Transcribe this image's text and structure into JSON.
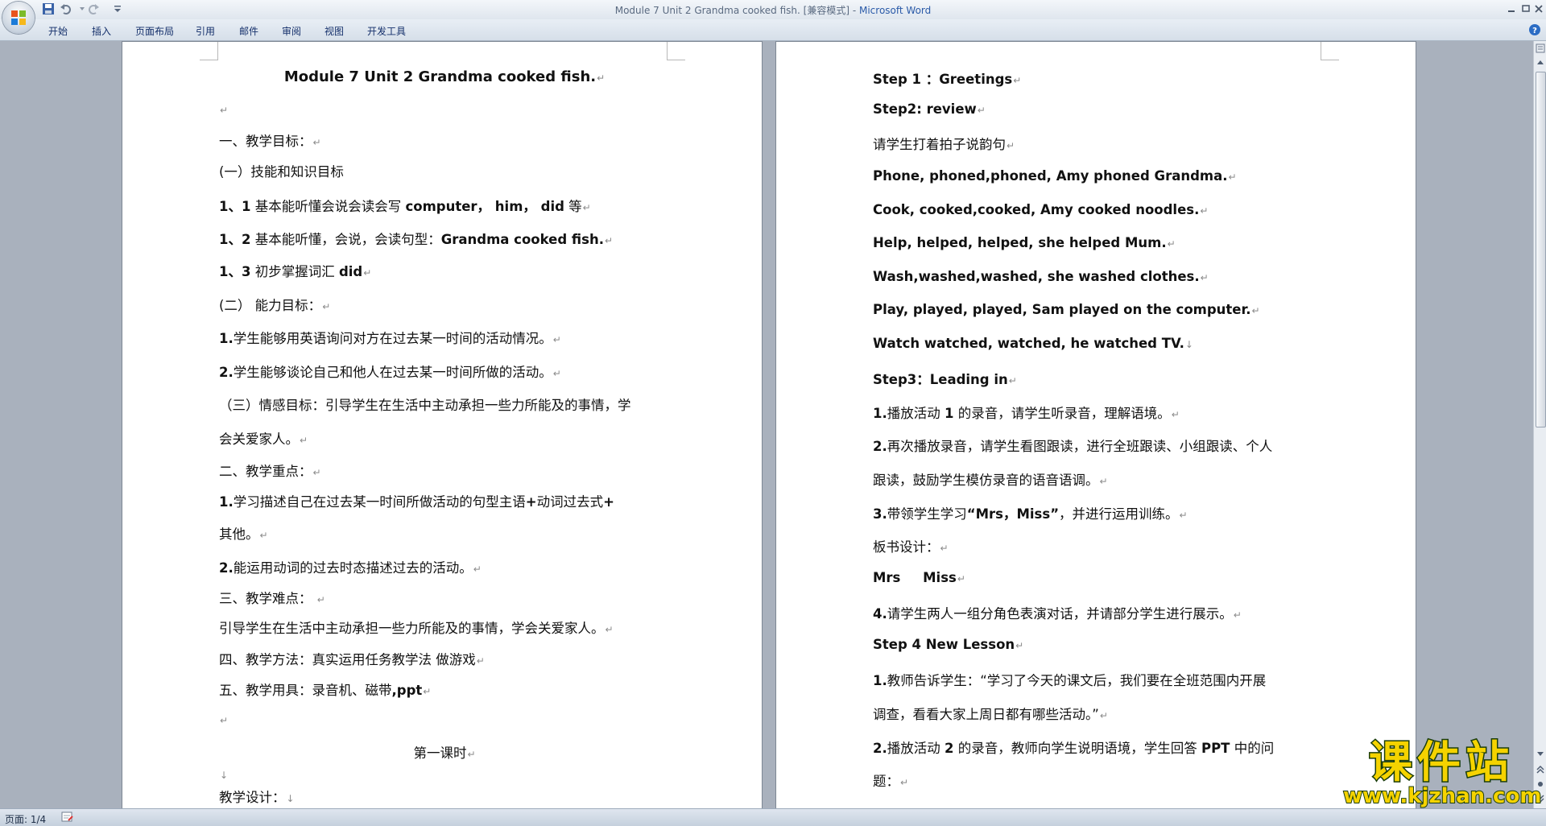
{
  "window": {
    "title_doc": "Module 7 Unit 2 Grandma cooked fish. [兼容模式] - ",
    "title_app": "Microsoft Word"
  },
  "ribbon": {
    "tabs": [
      "开始",
      "插入",
      "页面布局",
      "引用",
      "邮件",
      "审阅",
      "视图",
      "开发工具"
    ]
  },
  "left_page": {
    "title": "Module 7 Unit 2 Grandma cooked fish.",
    "goals_heading": "一、教学目标：",
    "skill_heading": "(一）技能和知识目标",
    "skill_1_num": "1、1",
    "skill_1_text": "基本能听懂会说会读会写",
    "skill_1_words": "computer， him， did",
    "skill_1_tail": "等",
    "skill_2_num": "1、2",
    "skill_2_text": "基本能听懂，会说，会读句型：",
    "skill_2_sentence": "Grandma cooked fish.",
    "skill_3_num": "1、3",
    "skill_3_text": "初步掌握词汇",
    "skill_3_word": "did",
    "ability_heading": "(二） 能力目标：",
    "ability_1": "学生能够用英语询问对方在过去某一时间的活动情况。",
    "ability_2": "学生能够谈论自己和他人在过去某一时间所做的活动。",
    "emotion_line1": "（三）情感目标：引导学生在生活中主动承担一些力所能及的事情，学",
    "emotion_line2": "会关爱家人。",
    "key_heading": "二、教学重点：",
    "key_1_line1a": "学习描述自己在过去某一时间所做活动的句型主语",
    "key_1_plus1": "+",
    "key_1_line1b": "动词过去式",
    "key_1_plus2": "+",
    "key_1_line2": "其他。",
    "key_2": "能运用动词的过去时态描述过去的活动。",
    "difficult_heading": "三、教学难点：",
    "difficult_text": "引导学生在生活中主动承担一些力所能及的事情，学会关爱家人。",
    "method": "四、教学方法：真实运用任务教学法 做游戏",
    "tools_text": "五、教学用具：录音机、磁带",
    "tools_ppt": ",ppt",
    "lesson_title": "第一课时",
    "design": "教学设计："
  },
  "right_page": {
    "step1": "Step 1 ：Greetings",
    "step2": "Step2: review",
    "chant_intro": "请学生打着拍子说韵句",
    "chant_1": "Phone, phoned,phoned, Amy phoned Grandma.",
    "chant_2": "Cook, cooked,cooked, Amy cooked noodles.",
    "chant_3": "Help, helped, helped, she helped Mum.",
    "chant_4": "Wash,washed,washed, she washed clothes.",
    "chant_5": "Play, played, played, Sam played on the computer.",
    "chant_6": "Watch watched, watched, he watched TV.",
    "step3": "Step3：Leading in",
    "s3_1a": "播放活动",
    "s3_1b": "的录音，请学生听录音，理解语境。",
    "s3_2_line1": "再次播放录音，请学生看图跟读，进行全班跟读、小组跟读、个人",
    "s3_2_line2": "跟读，鼓励学生模仿录音的语音语调。",
    "s3_3a": "带领学生学习",
    "s3_3_words": "“Mrs，Miss”",
    "s3_3b": "，并进行运用训练。",
    "board": "板书设计：",
    "board_words": "Mrs Miss",
    "s3_4": "请学生两人一组分角色表演对话，并请部分学生进行展示。",
    "step4": "Step 4 New Lesson",
    "s4_1_line1": "教师告诉学生：“学习了今天的课文后，我们要在全班范围内开展",
    "s4_1_line2": "调查，看看大家上周日都有哪些活动。”",
    "s4_2_line1a": "播放活动",
    "s4_2_line1b": "的录音，教师向学生说明语境，学生回答",
    "s4_2_ppt": "PPT",
    "s4_2_line1c": "中的问",
    "s4_2_line2": "题："
  },
  "numbers": {
    "n1": "1.",
    "n2": "2.",
    "n3": "3.",
    "n4": "4.",
    "one": "1",
    "two": "2"
  },
  "status": {
    "page": "页面: 1/4"
  },
  "watermark": {
    "title": "课件站",
    "url": "www.kjzhan.com"
  },
  "marks": {
    "para": "↵",
    "down": "↓"
  }
}
